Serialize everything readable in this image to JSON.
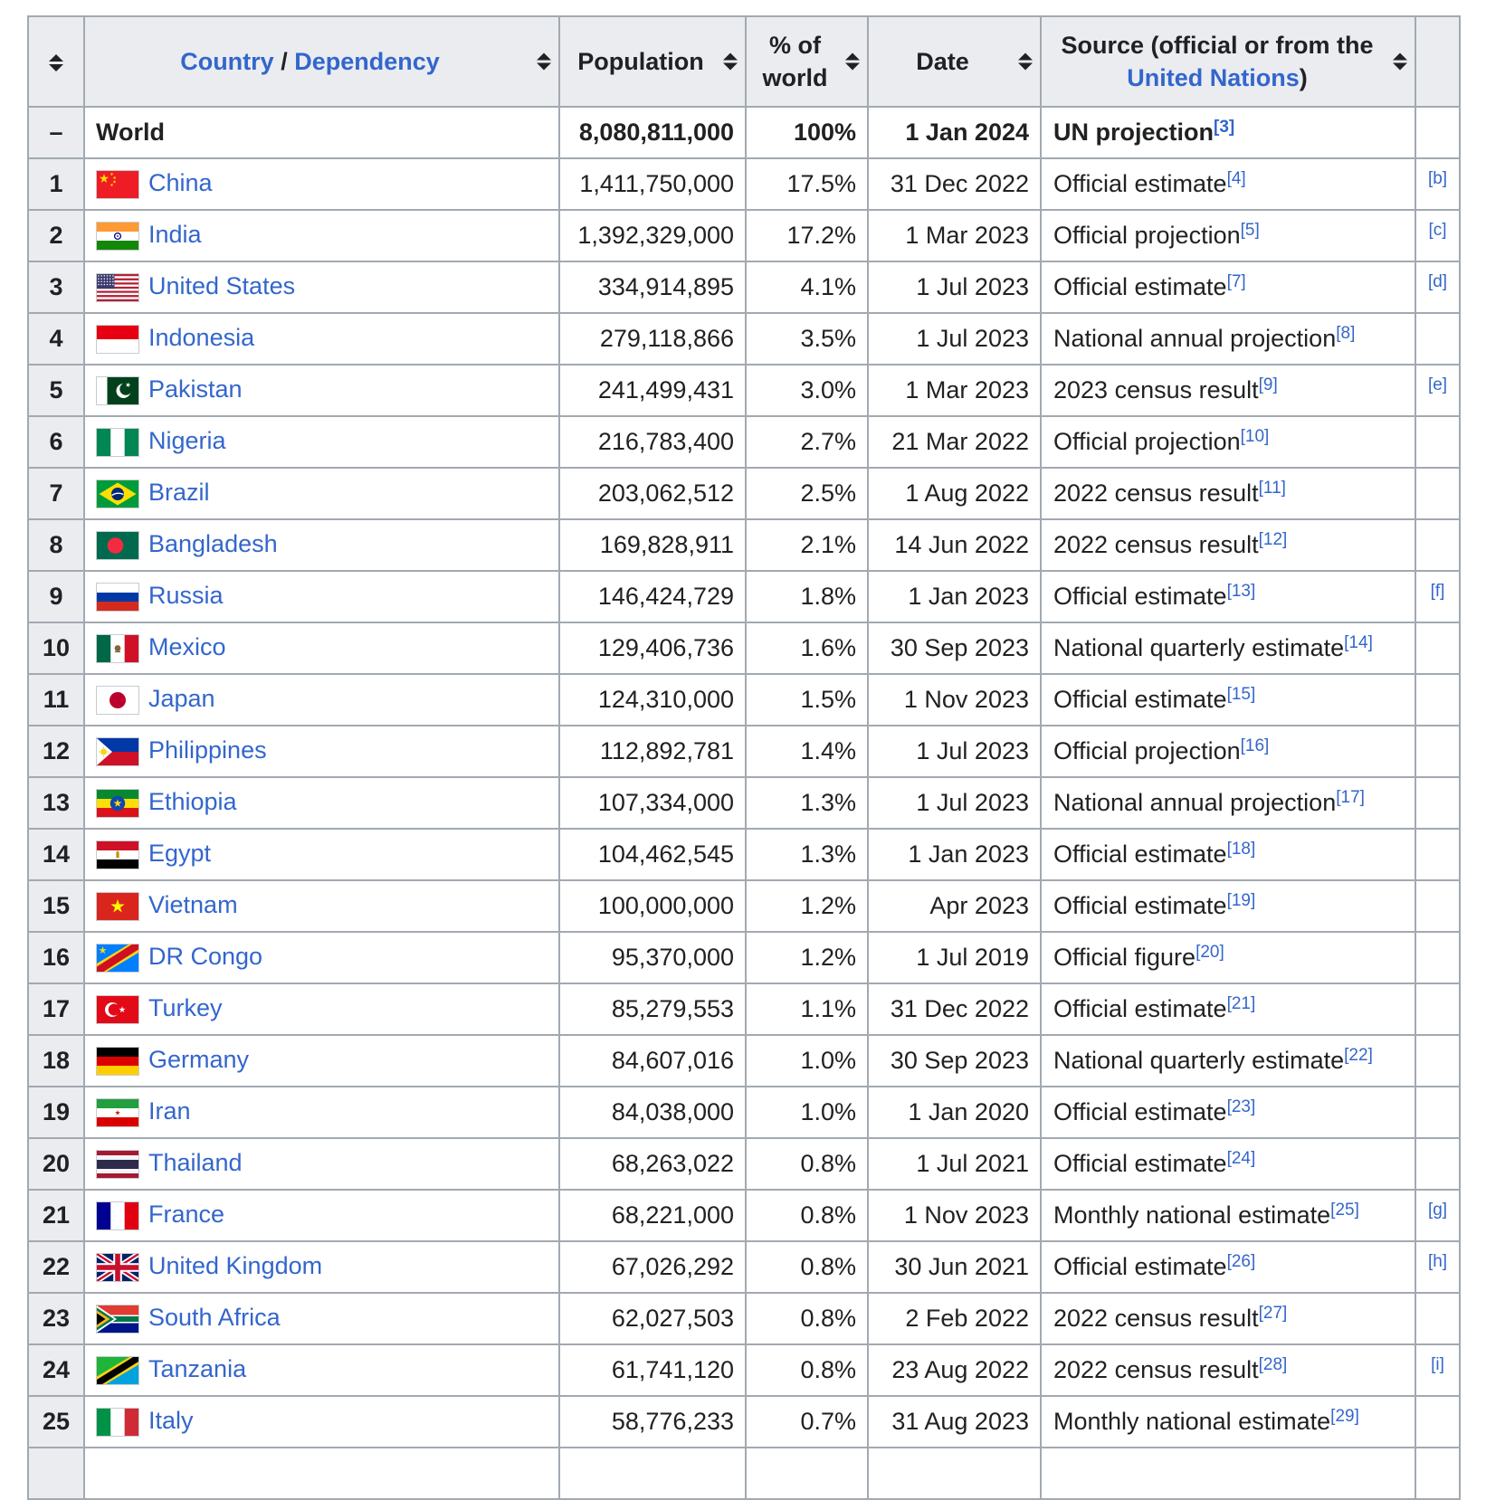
{
  "colors": {
    "link_blue": "#3366cc",
    "text": "#202122",
    "header_bg": "#eaecf0",
    "border": "#a2a9b1"
  },
  "header": {
    "country_link": "Country",
    "country_separator": " / ",
    "dependency_link": "Dependency",
    "population_label": "Population",
    "pct_label": "% of world",
    "date_label": "Date",
    "source_prefix": "Source (official or from the ",
    "source_link": "United Nations",
    "source_suffix": ")"
  },
  "world_row": {
    "rank": "–",
    "flag": "",
    "name": "World",
    "population": "8,080,811,000",
    "pct": "100%",
    "date": "1 Jan 2024",
    "source": "UN projection",
    "ref": "3",
    "note": ""
  },
  "rows": [
    {
      "rank": "1",
      "flag": "china",
      "name": "China",
      "population": "1,411,750,000",
      "pct": "17.5%",
      "date": "31 Dec 2022",
      "source": "Official estimate",
      "ref": "4",
      "note": "b"
    },
    {
      "rank": "2",
      "flag": "india",
      "name": "India",
      "population": "1,392,329,000",
      "pct": "17.2%",
      "date": "1 Mar 2023",
      "source": "Official projection",
      "ref": "5",
      "note": "c"
    },
    {
      "rank": "3",
      "flag": "us",
      "name": "United States",
      "population": "334,914,895",
      "pct": "4.1%",
      "date": "1 Jul 2023",
      "source": "Official estimate",
      "ref": "7",
      "note": "d"
    },
    {
      "rank": "4",
      "flag": "indonesia",
      "name": "Indonesia",
      "population": "279,118,866",
      "pct": "3.5%",
      "date": "1 Jul 2023",
      "source": "National annual projection",
      "ref": "8",
      "note": ""
    },
    {
      "rank": "5",
      "flag": "pakistan",
      "name": "Pakistan",
      "population": "241,499,431",
      "pct": "3.0%",
      "date": "1 Mar 2023",
      "source": "2023 census result",
      "ref": "9",
      "note": "e"
    },
    {
      "rank": "6",
      "flag": "nigeria",
      "name": "Nigeria",
      "population": "216,783,400",
      "pct": "2.7%",
      "date": "21 Mar 2022",
      "source": "Official projection",
      "ref": "10",
      "note": ""
    },
    {
      "rank": "7",
      "flag": "brazil",
      "name": "Brazil",
      "population": "203,062,512",
      "pct": "2.5%",
      "date": "1 Aug 2022",
      "source": "2022 census result",
      "ref": "11",
      "note": ""
    },
    {
      "rank": "8",
      "flag": "bangladesh",
      "name": "Bangladesh",
      "population": "169,828,911",
      "pct": "2.1%",
      "date": "14 Jun 2022",
      "source": "2022 census result",
      "ref": "12",
      "note": ""
    },
    {
      "rank": "9",
      "flag": "russia",
      "name": "Russia",
      "population": "146,424,729",
      "pct": "1.8%",
      "date": "1 Jan 2023",
      "source": "Official estimate",
      "ref": "13",
      "note": "f"
    },
    {
      "rank": "10",
      "flag": "mexico",
      "name": "Mexico",
      "population": "129,406,736",
      "pct": "1.6%",
      "date": "30 Sep 2023",
      "source": "National quarterly estimate",
      "ref": "14",
      "note": ""
    },
    {
      "rank": "11",
      "flag": "japan",
      "name": "Japan",
      "population": "124,310,000",
      "pct": "1.5%",
      "date": "1 Nov 2023",
      "source": "Official estimate",
      "ref": "15",
      "note": ""
    },
    {
      "rank": "12",
      "flag": "philippines",
      "name": "Philippines",
      "population": "112,892,781",
      "pct": "1.4%",
      "date": "1 Jul 2023",
      "source": "Official projection",
      "ref": "16",
      "note": ""
    },
    {
      "rank": "13",
      "flag": "ethiopia",
      "name": "Ethiopia",
      "population": "107,334,000",
      "pct": "1.3%",
      "date": "1 Jul 2023",
      "source": "National annual projection",
      "ref": "17",
      "note": ""
    },
    {
      "rank": "14",
      "flag": "egypt",
      "name": "Egypt",
      "population": "104,462,545",
      "pct": "1.3%",
      "date": "1 Jan 2023",
      "source": "Official estimate",
      "ref": "18",
      "note": ""
    },
    {
      "rank": "15",
      "flag": "vietnam",
      "name": "Vietnam",
      "population": "100,000,000",
      "pct": "1.2%",
      "date": "Apr 2023",
      "source": "Official estimate",
      "ref": "19",
      "note": ""
    },
    {
      "rank": "16",
      "flag": "drcongo",
      "name": "DR Congo",
      "population": "95,370,000",
      "pct": "1.2%",
      "date": "1 Jul 2019",
      "source": "Official figure",
      "ref": "20",
      "note": ""
    },
    {
      "rank": "17",
      "flag": "turkey",
      "name": "Turkey",
      "population": "85,279,553",
      "pct": "1.1%",
      "date": "31 Dec 2022",
      "source": "Official estimate",
      "ref": "21",
      "note": ""
    },
    {
      "rank": "18",
      "flag": "germany",
      "name": "Germany",
      "population": "84,607,016",
      "pct": "1.0%",
      "date": "30 Sep 2023",
      "source": "National quarterly estimate",
      "ref": "22",
      "note": ""
    },
    {
      "rank": "19",
      "flag": "iran",
      "name": "Iran",
      "population": "84,038,000",
      "pct": "1.0%",
      "date": "1 Jan 2020",
      "source": "Official estimate",
      "ref": "23",
      "note": ""
    },
    {
      "rank": "20",
      "flag": "thailand",
      "name": "Thailand",
      "population": "68,263,022",
      "pct": "0.8%",
      "date": "1 Jul 2021",
      "source": "Official estimate",
      "ref": "24",
      "note": ""
    },
    {
      "rank": "21",
      "flag": "france",
      "name": "France",
      "population": "68,221,000",
      "pct": "0.8%",
      "date": "1 Nov 2023",
      "source": "Monthly national estimate",
      "ref": "25",
      "note": "g"
    },
    {
      "rank": "22",
      "flag": "uk",
      "name": "United Kingdom",
      "population": "67,026,292",
      "pct": "0.8%",
      "date": "30 Jun 2021",
      "source": "Official estimate",
      "ref": "26",
      "note": "h"
    },
    {
      "rank": "23",
      "flag": "southafrica",
      "name": "South Africa",
      "population": "62,027,503",
      "pct": "0.8%",
      "date": "2 Feb 2022",
      "source": "2022 census result",
      "ref": "27",
      "note": ""
    },
    {
      "rank": "24",
      "flag": "tanzania",
      "name": "Tanzania",
      "population": "61,741,120",
      "pct": "0.8%",
      "date": "23 Aug 2022",
      "source": "2022 census result",
      "ref": "28",
      "note": "i"
    },
    {
      "rank": "25",
      "flag": "italy",
      "name": "Italy",
      "population": "58,776,233",
      "pct": "0.7%",
      "date": "31 Aug 2023",
      "source": "Monthly national estimate",
      "ref": "29",
      "note": ""
    }
  ]
}
